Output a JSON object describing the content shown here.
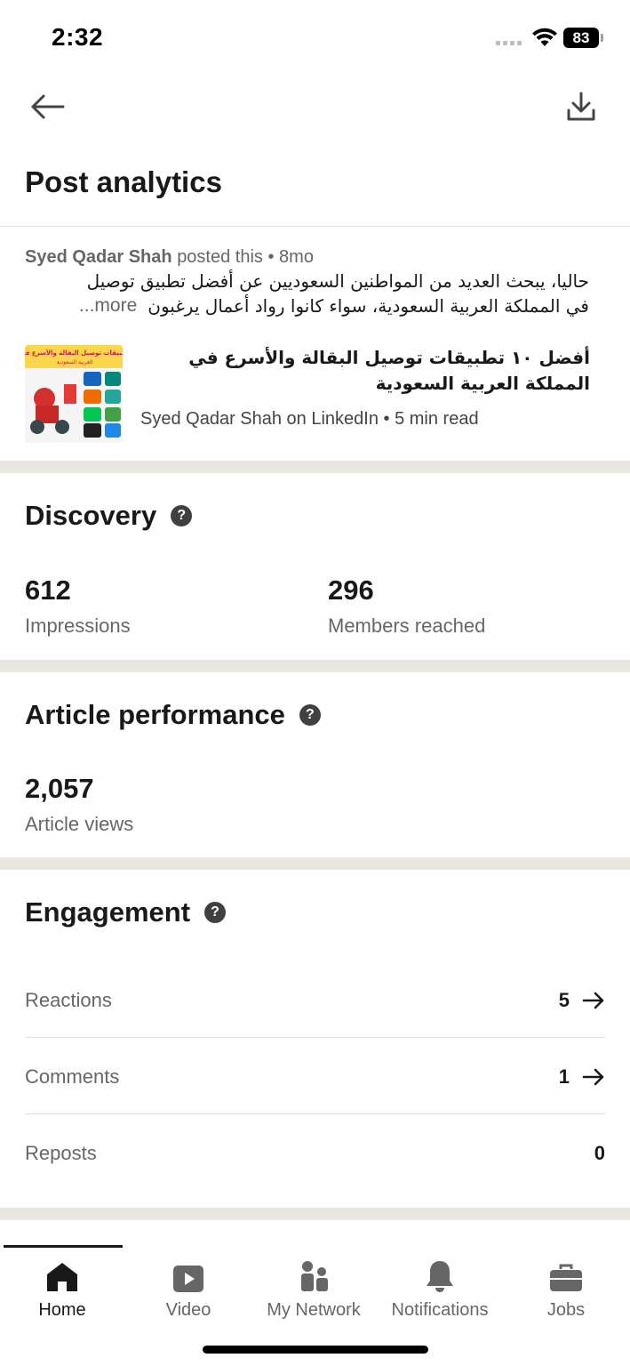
{
  "status_bar": {
    "time": "2:32",
    "battery": "83"
  },
  "header": {
    "back_icon": "arrow-left-icon",
    "download_icon": "download-icon",
    "title": "Post analytics"
  },
  "post": {
    "author": "Syed Qadar Shah",
    "meta_suffix": "posted this • 8mo",
    "text_line1": "حاليا، يبحث العديد من المواطنين السعوديين عن أفضل تطبيق توصيل",
    "text_line2": "في المملكة العربية السعودية، سواء كانوا رواد أعمال يرغبون",
    "more_label": "...more",
    "article": {
      "title": "أفضل ١٠ تطبيقات توصيل البقالة والأسرع في المملكة العربية السعودية",
      "subtitle": "Syed Qadar Shah on LinkedIn • 5 min read",
      "thumb_caption": "تطبيقات توصيل البقالة والأسرع في العربية السعودية"
    }
  },
  "discovery": {
    "title": "Discovery",
    "impressions_value": "612",
    "impressions_label": "Impressions",
    "members_value": "296",
    "members_label": "Members reached"
  },
  "article_performance": {
    "title": "Article performance",
    "views_value": "2,057",
    "views_label": "Article views"
  },
  "engagement": {
    "title": "Engagement",
    "rows": [
      {
        "label": "Reactions",
        "value": "5"
      },
      {
        "label": "Comments",
        "value": "1"
      },
      {
        "label": "Reposts",
        "value": "0"
      }
    ]
  },
  "tabbar": {
    "tabs": [
      {
        "label": "Home",
        "icon": "home-icon"
      },
      {
        "label": "Video",
        "icon": "video-icon"
      },
      {
        "label": "My Network",
        "icon": "network-icon"
      },
      {
        "label": "Notifications",
        "icon": "bell-icon"
      },
      {
        "label": "Jobs",
        "icon": "briefcase-icon"
      }
    ]
  }
}
